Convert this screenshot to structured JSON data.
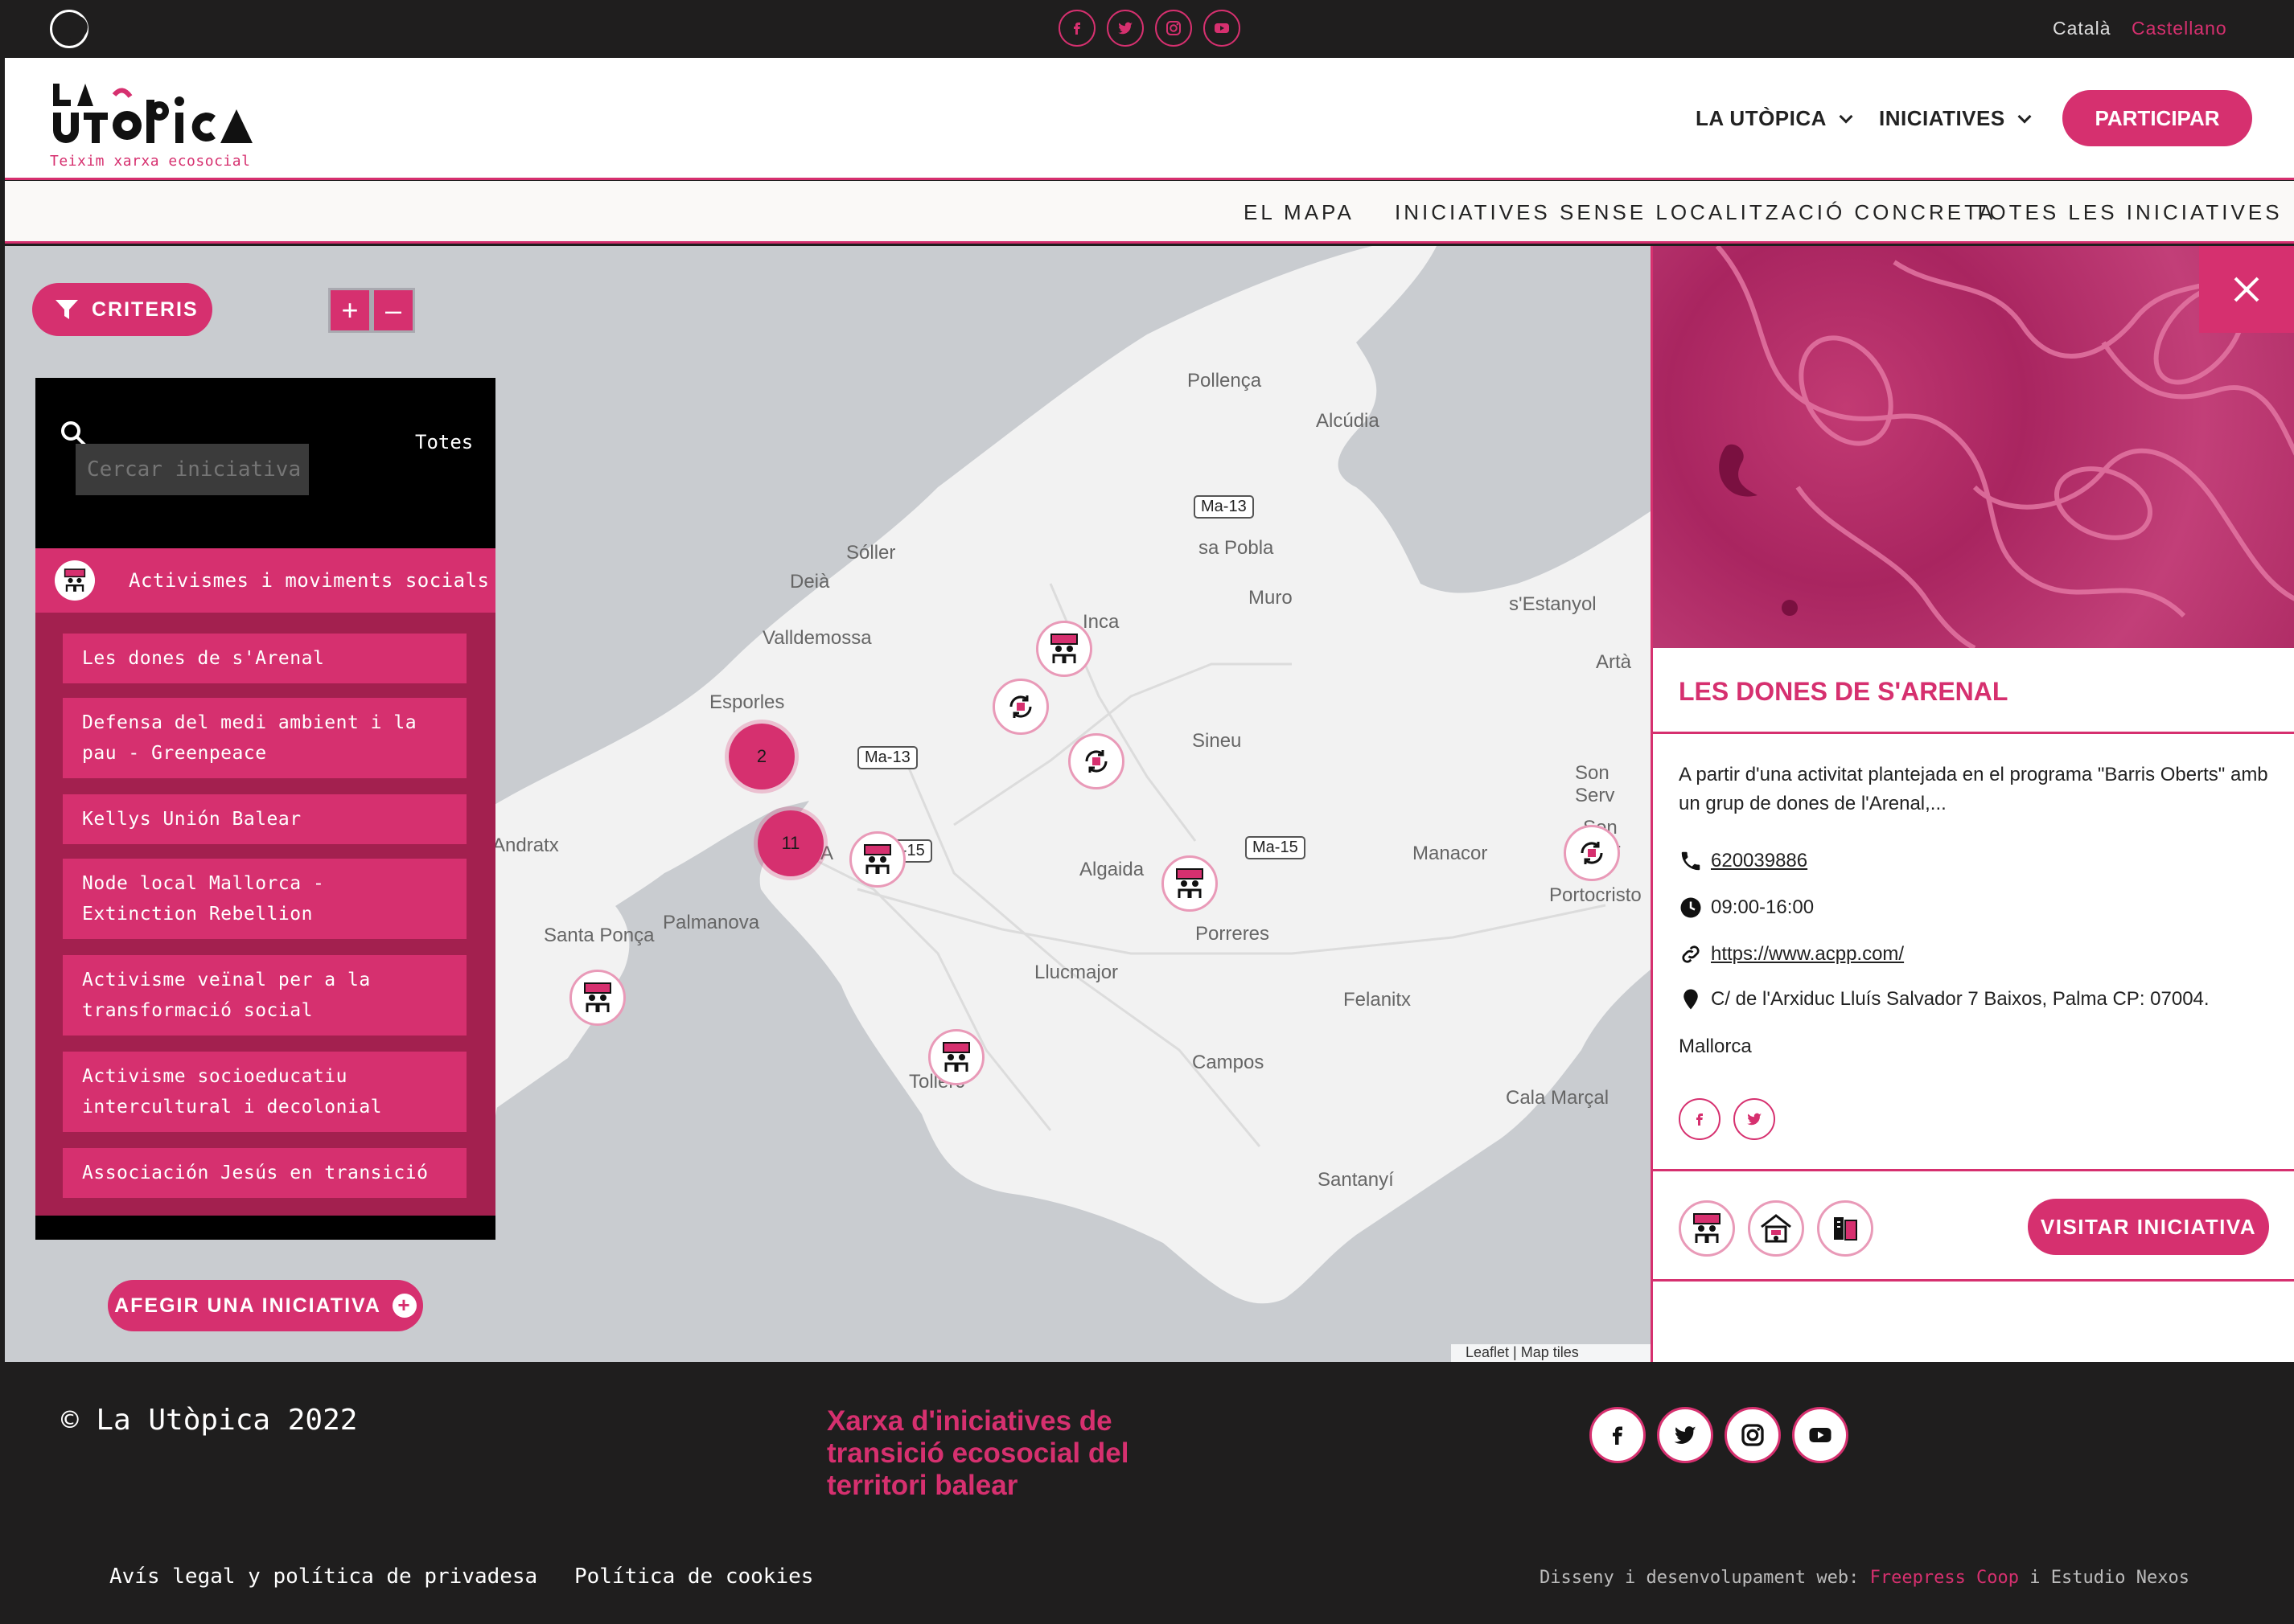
{
  "topbar": {
    "lang_ca": "Català",
    "lang_es": "Castellano",
    "social": [
      "facebook-icon",
      "twitter-icon",
      "instagram-icon",
      "youtube-icon"
    ]
  },
  "header": {
    "tagline": "Teixim xarxa ecosocial",
    "nav": [
      "LA UTÒPICA",
      "INICIATIVES"
    ],
    "cta": "PARTICIPAR"
  },
  "subnav": [
    "EL MAPA",
    "INICIATIVES SENSE LOCALITZACIÓ CONCRETA",
    "TOTES LES INICIATIVES"
  ],
  "map": {
    "criteris": "CRITERIS",
    "zoom_in": "+",
    "zoom_out": "–",
    "places": [
      "Pollença",
      "Alcúdia",
      "Sóller",
      "sa Pobla",
      "Deià",
      "Muro",
      "s'Estanyol",
      "Valldemossa",
      "Inca",
      "Artà",
      "Esporles",
      "Sineu",
      "Son Serv",
      "Son Carr",
      "Andratx",
      "Manacor",
      "Algaida",
      "Portocristo",
      "Santa Ponça",
      "Palmanova",
      "Porreres",
      "Llucmajor",
      "Felanitx",
      "Campos",
      "Cala Marçal",
      "Santanyí",
      "Tollerc",
      "A"
    ],
    "roads": [
      "Ma-13",
      "Ma-13",
      "Ma-15",
      "Ma-15"
    ],
    "clusters": [
      "2",
      "11"
    ],
    "attribution": "Leaflet | Map tiles"
  },
  "panel": {
    "search_placeholder": "Cercar iniciativa",
    "filter": "Totes",
    "category": "Activismes i moviments socials",
    "items": [
      "Les dones de s'Arenal",
      "Defensa del medi ambient i la pau - Greenpeace",
      "Kellys Unión Balear",
      "Node local Mallorca - Extinction Rebellion",
      "Activisme veïnal per a la transformació social",
      "Activisme socioeducatiu intercultural i decolonial",
      "Associación Jesús en transició"
    ],
    "add_button": "AFEGIR UNA INICIATIVA"
  },
  "detail": {
    "title": "LES DONES DE S'ARENAL",
    "description": "A partir d'una activitat plantejada en el programa \"Barris Oberts\" amb un grup de dones de l'Arenal,...",
    "phone": "620039886",
    "hours": "09:00-16:00",
    "website": "https://www.acpp.com/",
    "address": "C/ de l'Arxiduc Lluís Salvador 7 Baixos, Palma CP: 07004.",
    "island": "Mallorca",
    "visit_button": "VISITAR INICIATIVA"
  },
  "footer": {
    "copyright": "© La Utòpica 2022",
    "tagline": "Xarxa d'iniciatives de transició ecosocial del territori balear",
    "legal": "Avís legal y política de privadesa",
    "cookies": "Política de cookies",
    "credits_prefix": "Disseny i desenvolupament web:",
    "credits_link": "Freepress Coop",
    "credits_suffix": "i Estudio Nexos"
  },
  "colors": {
    "accent": "#d6306f",
    "dark": "#1f1e1e",
    "map_sea": "#c9ccd0",
    "map_land": "#f2f2f2"
  }
}
